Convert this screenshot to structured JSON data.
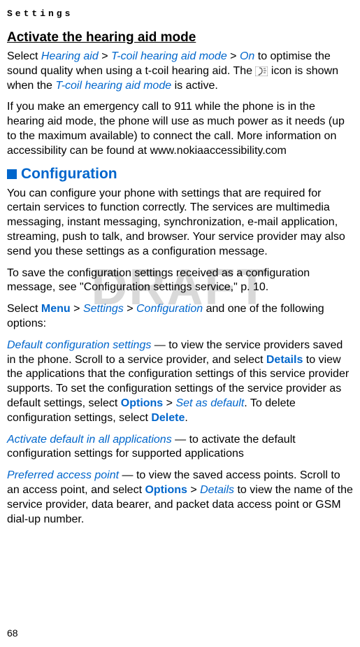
{
  "chapter": "Settings",
  "watermark": "DRAFT",
  "pageNumber": "68",
  "hearingAid": {
    "heading": "Activate the hearing aid mode",
    "p1_select": "Select ",
    "p1_link1": "Hearing aid",
    "p1_gt1": " > ",
    "p1_link2": "T-coil hearing aid mode",
    "p1_gt2": " > ",
    "p1_link3": "On",
    "p1_mid": " to optimise the sound quality when using a t-coil hearing aid. The ",
    "p1_after_icon": " icon is shown when the ",
    "p1_link4": "T-coil hearing aid mode",
    "p1_end": " is active.",
    "p2": "If you make an emergency call to 911 while the phone is in the hearing aid mode, the phone will use as much power as it needs (up to the maximum available) to connect the call. More information on accessibility can be found at www.nokiaaccessibility.com"
  },
  "config": {
    "heading": "Configuration",
    "p1": "You can configure your phone with settings that are required for certain services to function correctly. The services are multimedia messaging, instant messaging, synchronization, e-mail application, streaming, push to talk, and browser. Your service provider may also send you these settings as a configuration message.",
    "p2": "To save the configuration settings received as a configuration message, see \"Configuration settings service,\" p. 10.",
    "p3_select": "Select ",
    "p3_menu": "Menu",
    "p3_gt1": " > ",
    "p3_settings": "Settings",
    "p3_gt2": " > ",
    "p3_config": "Configuration",
    "p3_end": " and one of the following options:",
    "item1_label": "Default configuration settings",
    "item1_a": " — to view the service providers saved in the phone. Scroll to a service provider, and select ",
    "item1_details": "Details",
    "item1_b": " to view the applications that the configuration settings of this service provider supports. To set the configuration settings of the service provider as default settings, select ",
    "item1_options": "Options",
    "item1_gt": " > ",
    "item1_setdefault": "Set as default",
    "item1_c": ". To delete configuration settings, select ",
    "item1_delete": "Delete",
    "item1_end": ".",
    "item2_label": "Activate default in all applications",
    "item2_text": " — to activate the default configuration settings for supported applications",
    "item3_label": "Preferred access point",
    "item3_a": " — to view the saved access points. Scroll to an access point, and select ",
    "item3_options": "Options",
    "item3_gt": " > ",
    "item3_details": "Details",
    "item3_b": " to view the name of the service provider, data bearer, and packet data access point or GSM dial-up number."
  }
}
